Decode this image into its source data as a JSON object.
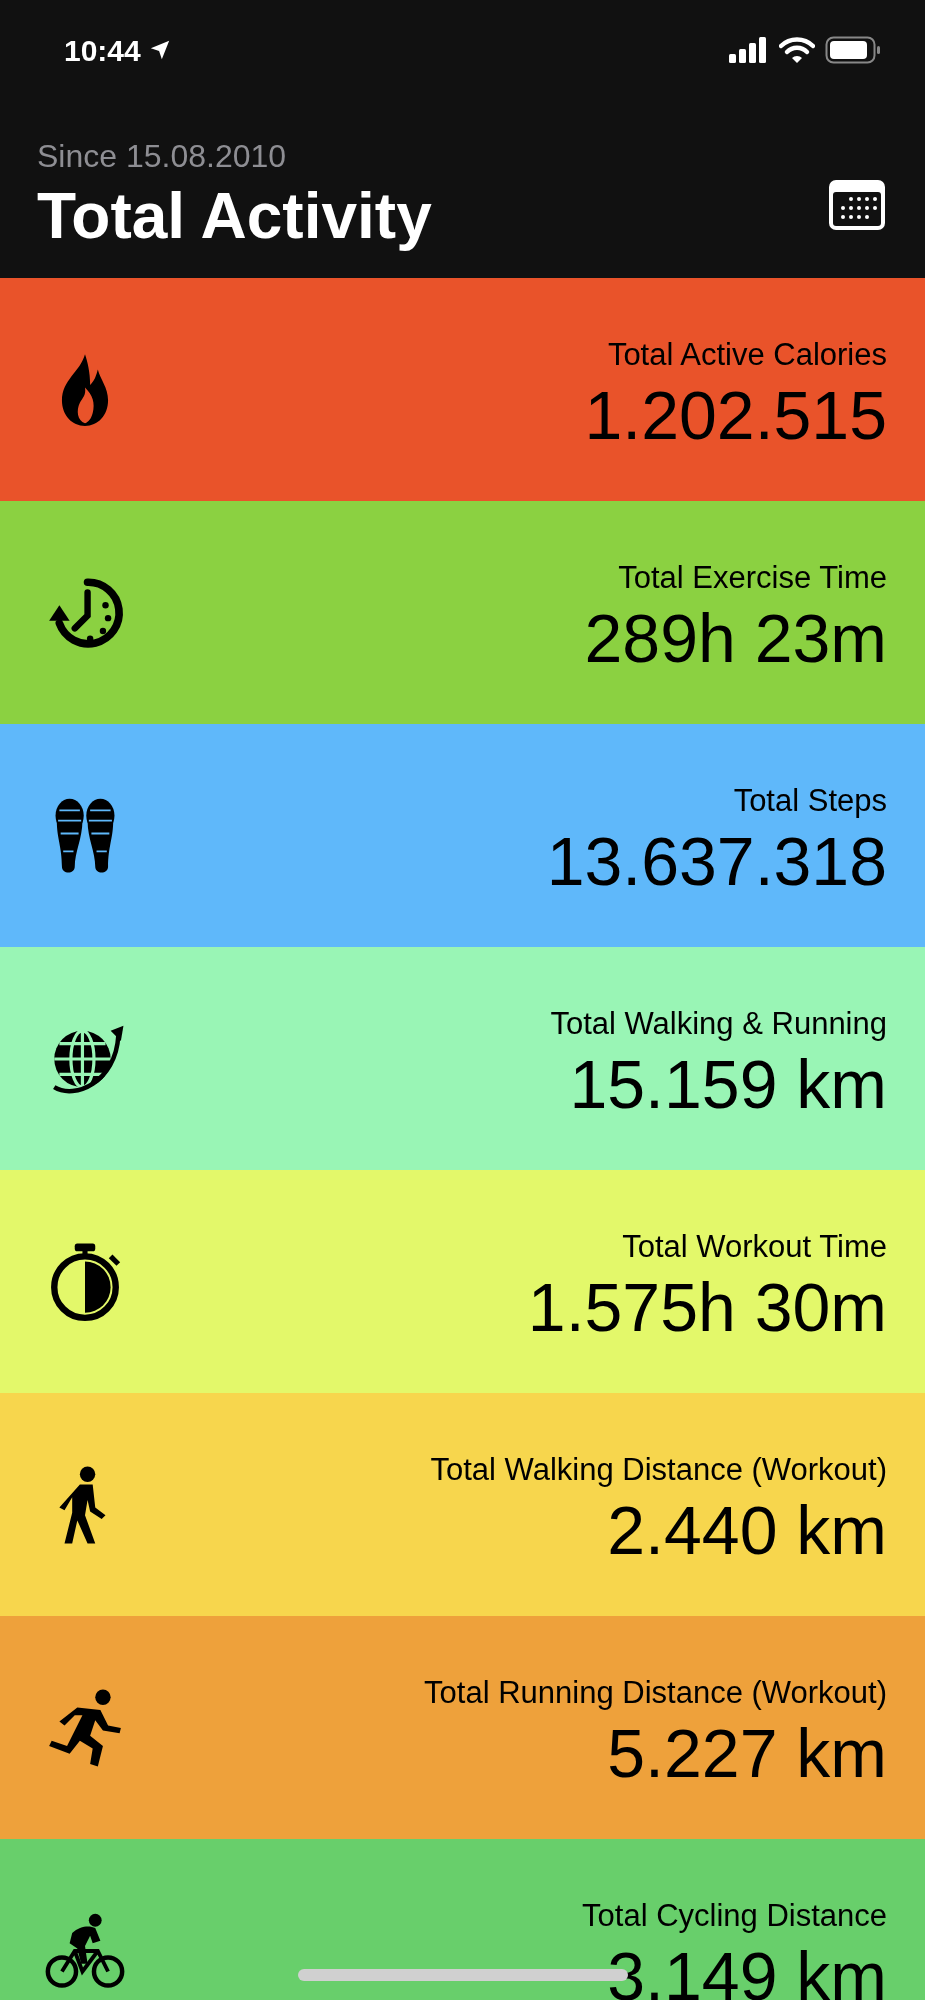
{
  "status_bar": {
    "time": "10:44"
  },
  "header": {
    "subtitle": "Since 15.08.2010",
    "title": "Total Activity"
  },
  "stats": [
    {
      "kind": "calories",
      "label": "Total Active Calories",
      "value": "1.202.515",
      "color": "#e9532a"
    },
    {
      "kind": "exercise",
      "label": "Total Exercise Time",
      "value": "289h 23m",
      "color": "#8bd141"
    },
    {
      "kind": "steps",
      "label": "Total Steps",
      "value": "13.637.318",
      "color": "#5fb8fa"
    },
    {
      "kind": "distance",
      "label": "Total Walking & Running",
      "value": "15.159 km",
      "color": "#99f5b5"
    },
    {
      "kind": "workout",
      "label": "Total Workout Time",
      "value": "1.575h 30m",
      "color": "#e3f86a"
    },
    {
      "kind": "walking",
      "label": "Total Walking Distance (Workout)",
      "value": "2.440 km",
      "color": "#f7d64d"
    },
    {
      "kind": "running",
      "label": "Total Running Distance (Workout)",
      "value": "5.227 km",
      "color": "#eea13b"
    },
    {
      "kind": "cycling",
      "label": "Total Cycling Distance",
      "value": "3.149 km",
      "color": "#68cf6b"
    }
  ]
}
